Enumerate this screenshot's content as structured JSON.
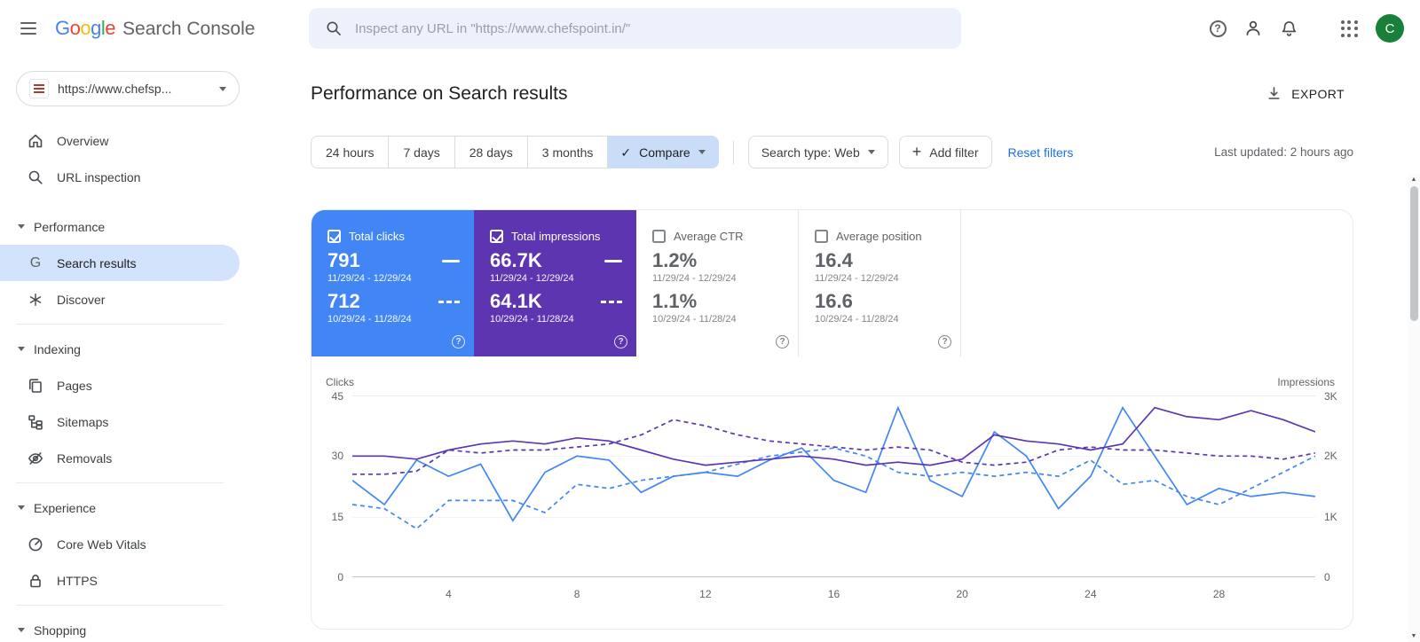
{
  "topbar": {
    "logo_letters": [
      "G",
      "o",
      "o",
      "g",
      "l",
      "e"
    ],
    "product_name": "Search Console",
    "search_placeholder": "Inspect any URL in \"https://www.chefspoint.in/\"",
    "avatar_letter": "C"
  },
  "sidebar": {
    "property_label": "https://www.chefsp...",
    "overview": "Overview",
    "url_inspection": "URL inspection",
    "performance_section": "Performance",
    "search_results": "Search results",
    "discover": "Discover",
    "indexing_section": "Indexing",
    "pages": "Pages",
    "sitemaps": "Sitemaps",
    "removals": "Removals",
    "experience_section": "Experience",
    "core_web_vitals": "Core Web Vitals",
    "https": "HTTPS",
    "shopping_section": "Shopping"
  },
  "main": {
    "title": "Performance on Search results",
    "export_label": "EXPORT",
    "date_ranges": [
      "24 hours",
      "7 days",
      "28 days",
      "3 months"
    ],
    "compare_label": "Compare",
    "search_type_label": "Search type: Web",
    "add_filter_label": "Add filter",
    "reset_filters_label": "Reset filters",
    "last_updated": "Last updated: 2 hours ago"
  },
  "cards": [
    {
      "label": "Total clicks",
      "checked": true,
      "color": "#4285f4",
      "value_current": "791",
      "range_current": "11/29/24 - 12/29/24",
      "value_previous": "712",
      "range_previous": "10/29/24 - 11/28/24"
    },
    {
      "label": "Total impressions",
      "checked": true,
      "color": "#5e35b1",
      "value_current": "66.7K",
      "range_current": "11/29/24 - 12/29/24",
      "value_previous": "64.1K",
      "range_previous": "10/29/24 - 11/28/24"
    },
    {
      "label": "Average CTR",
      "checked": false,
      "value_current": "1.2%",
      "range_current": "11/29/24 - 12/29/24",
      "value_previous": "1.1%",
      "range_previous": "10/29/24 - 11/28/24"
    },
    {
      "label": "Average position",
      "checked": false,
      "value_current": "16.4",
      "range_current": "11/29/24 - 12/29/24",
      "value_previous": "16.6",
      "range_previous": "10/29/24 - 11/28/24"
    }
  ],
  "chart_data": {
    "type": "line",
    "title": "Performance on Search results",
    "x_range": [
      1,
      31
    ],
    "x_label_ticks": [
      4,
      8,
      12,
      16,
      20,
      24,
      28
    ],
    "left_axis": {
      "title": "Clicks",
      "max": 45,
      "ticks": [
        "45",
        "30",
        "15",
        "0"
      ]
    },
    "right_axis": {
      "title": "Impressions",
      "max": 3000,
      "ticks": [
        "3K",
        "2K",
        "1K",
        "0"
      ]
    },
    "grid": true,
    "legend_position": "none",
    "series": [
      {
        "name": "Total clicks 11/29/24 - 12/29/24",
        "axis": "left",
        "style": "solid",
        "color": "#4285f4",
        "values": [
          24,
          18,
          29,
          25,
          28,
          14,
          26,
          30,
          29,
          21,
          25,
          26,
          25,
          29,
          32,
          24,
          21,
          42,
          24,
          20,
          36,
          30,
          17,
          25,
          42,
          30,
          18,
          22,
          20,
          21,
          20
        ]
      },
      {
        "name": "Total clicks 10/29/24 - 11/28/24",
        "axis": "left",
        "style": "dashed",
        "color": "#4285f4",
        "values": [
          18,
          17,
          12,
          19,
          19,
          19,
          16,
          23,
          22,
          24,
          25,
          26,
          28,
          30,
          31,
          32,
          30,
          26,
          25,
          26,
          25,
          26,
          25,
          29,
          23,
          24,
          20,
          18,
          22,
          26,
          30
        ]
      },
      {
        "name": "Total impressions 11/29/24 - 12/29/24",
        "axis": "right",
        "style": "solid",
        "color": "#5e35b1",
        "values": [
          2000,
          2000,
          1950,
          2100,
          2200,
          2250,
          2200,
          2300,
          2250,
          2100,
          1950,
          1850,
          1900,
          1950,
          2000,
          1950,
          1850,
          1900,
          1850,
          1950,
          2350,
          2250,
          2200,
          2100,
          2200,
          2800,
          2650,
          2600,
          2750,
          2600,
          2400
        ]
      },
      {
        "name": "Total impressions 10/29/24 - 11/28/24",
        "axis": "right",
        "style": "dashed",
        "color": "#5e35b1",
        "values": [
          1700,
          1700,
          1750,
          2100,
          2050,
          2100,
          2100,
          2150,
          2200,
          2350,
          2600,
          2500,
          2350,
          2250,
          2200,
          2150,
          2100,
          2150,
          2100,
          1900,
          1850,
          1900,
          2100,
          2150,
          2100,
          2100,
          2050,
          2000,
          2000,
          1950,
          2050
        ]
      }
    ]
  }
}
